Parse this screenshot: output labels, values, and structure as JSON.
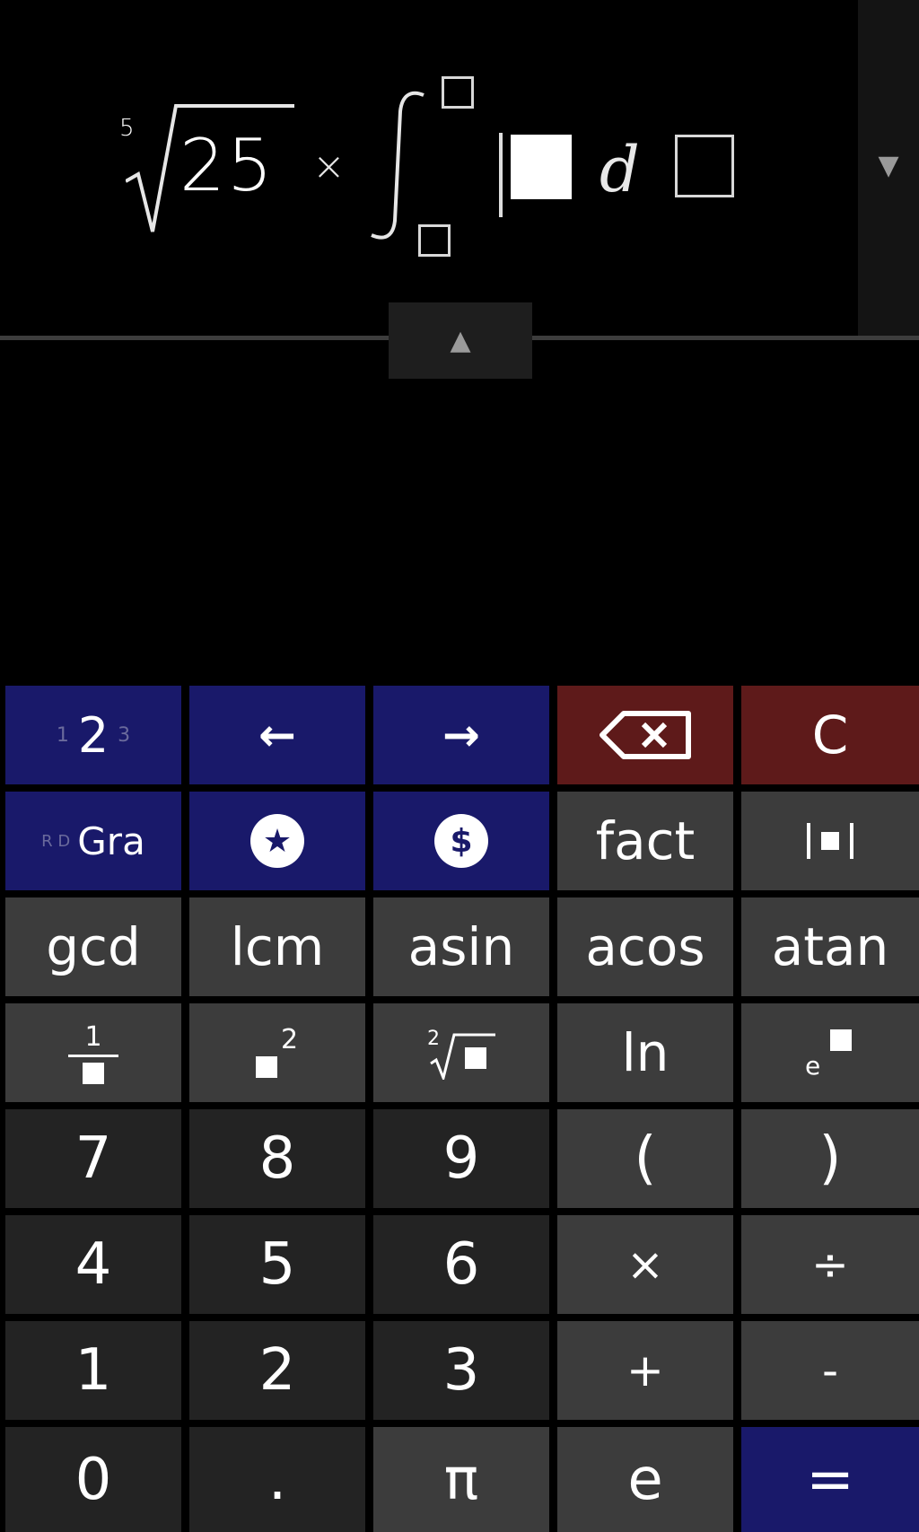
{
  "expression": {
    "root_index": "5",
    "radicand": "25",
    "operator": "×",
    "integral_symbol": "∫",
    "differential": "d"
  },
  "icons": {
    "side_toggle": "triangle-down-icon",
    "collapse_toggle": "triangle-up-icon",
    "backspace": "backspace-icon",
    "favorites": "star-icon",
    "currency": "dollar-icon",
    "abs": "absolute-value-icon"
  },
  "glyphs": {
    "side_arrow": "▼",
    "collapse_arrow": "▲",
    "left_arrow": "←",
    "right_arrow": "→",
    "star": "★",
    "dollar": "$"
  },
  "keypad": {
    "row1": {
      "decimals": {
        "left": "1",
        "current": "2",
        "right": "3"
      },
      "clear": "C"
    },
    "row2": {
      "angle_mode": {
        "prefix": "R D",
        "current": "Gra"
      },
      "fact": "fact"
    },
    "row3": [
      "gcd",
      "lcm",
      "asin",
      "acos",
      "atan"
    ],
    "row4": {
      "reciprocal_numerator": "1",
      "square_exponent": "2",
      "root_index": "2",
      "ln": "ln",
      "exp_base": "e"
    },
    "digits": {
      "seven": "7",
      "eight": "8",
      "nine": "9",
      "open_paren": "(",
      "close_paren": ")",
      "four": "4",
      "five": "5",
      "six": "6",
      "multiply": "×",
      "divide": "÷",
      "one": "1",
      "two": "2",
      "three": "3",
      "plus": "+",
      "minus": "-",
      "zero": "0",
      "decimal": ".",
      "pi": "π",
      "e": "e",
      "equals": "="
    }
  },
  "colors": {
    "blue_key": "#19196a",
    "red_key": "#5e1a1a",
    "function_key": "#3c3c3c",
    "number_key": "#232323"
  }
}
